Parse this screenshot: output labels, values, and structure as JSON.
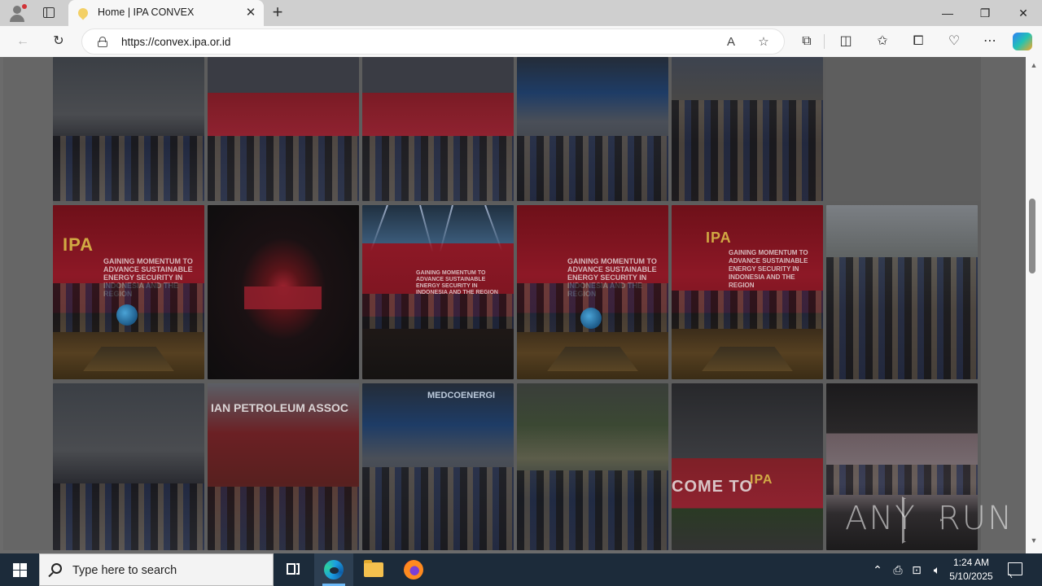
{
  "browser": {
    "tab": {
      "title": "Home | IPA CONVEX"
    },
    "address": {
      "url": "https://convex.ipa.or.id"
    },
    "window_controls": [
      "minimize",
      "restore",
      "close"
    ],
    "accent": "#0078d4"
  },
  "gallery": {
    "overlay_dimmed": true,
    "rows": [
      {
        "photos": [
          {
            "label": "venue-hall-crowd"
          },
          {
            "label": "red-entrance-crowd"
          },
          {
            "label": "registration-hall"
          },
          {
            "label": "booth-visitors-desk"
          },
          {
            "label": "networking-crowd"
          },
          {
            "label": "empty-slot"
          }
        ]
      },
      {
        "photos": [
          {
            "label": "opening-stage-delegates"
          },
          {
            "label": "dark-auditorium-stage"
          },
          {
            "label": "stage-light-show"
          },
          {
            "label": "opening-stage-globe"
          },
          {
            "label": "stage-wide-delegates"
          },
          {
            "label": "vip-walkthrough"
          }
        ]
      },
      {
        "photos": [
          {
            "label": "glass-hall-seating"
          },
          {
            "label": "petroleum-association-booth"
          },
          {
            "label": "medco-energi-booth"
          },
          {
            "label": "students-seated"
          },
          {
            "label": "welcome-banner"
          },
          {
            "label": "award-ceremony"
          }
        ]
      }
    ],
    "stage_text": "GAINING MOMENTUM TO ADVANCE SUSTAINABLE ENERGY SECURITY IN INDONESIA AND THE REGION",
    "ipa_text": "IPA",
    "booth_text": "IAN PETROLEUM ASSOC",
    "medco_text": "MEDCOENERGI",
    "banner_text": "COME TO",
    "brand_red": "#8f2230"
  },
  "watermark": {
    "text_left": "ANY",
    "text_right": "RUN"
  },
  "taskbar": {
    "search_placeholder": "Type here to search",
    "apps": [
      "task-view",
      "edge",
      "file-explorer",
      "firefox"
    ],
    "clock": {
      "time": "1:24 AM",
      "date": "5/10/2025"
    }
  }
}
